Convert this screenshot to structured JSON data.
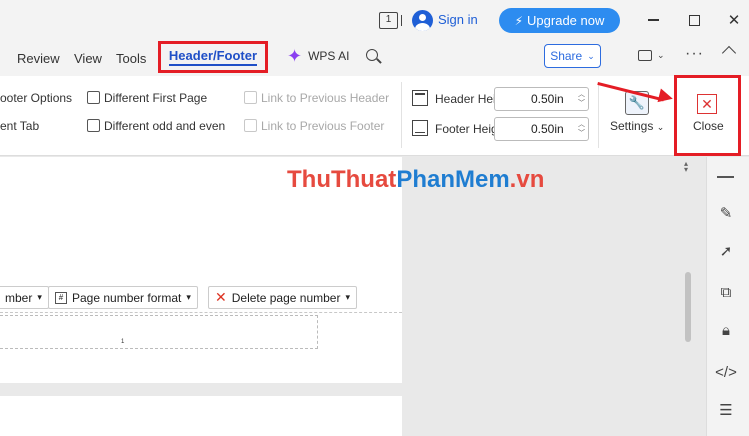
{
  "titlebar": {
    "page_count": "1",
    "signin_label": "Sign in",
    "upgrade_label": "Upgrade now"
  },
  "menu": {
    "items": [
      "Review",
      "View",
      "Tools"
    ],
    "active_tab": "Header/Footer",
    "wps_ai_label": "WPS AI",
    "share_label": "Share"
  },
  "ribbon": {
    "footer_options_label": "ooter Options",
    "ent_tab_label": "ent Tab",
    "different_first_page": "Different First Page",
    "different_odd_even": "Different odd and even",
    "link_prev_header": "Link to Previous Header",
    "link_prev_footer": "Link to Previous Footer",
    "header_height_label": "Header Height:",
    "header_height_value": "0.50in",
    "footer_height_label": "Footer Height:",
    "footer_height_value": "0.50in",
    "settings_label": "Settings",
    "close_label": "Close"
  },
  "watermark": {
    "part1": "ThuThuat",
    "part2": "PhanMem",
    "part3": ".vn"
  },
  "document": {
    "page_number_btn": "mber",
    "page_number_format_btn": "Page number format",
    "delete_page_number_btn": "Delete page number",
    "footer_page_number": "1"
  },
  "colors": {
    "highlight_red": "#e41d25",
    "accent_blue": "#2d8cf0",
    "active_tab_blue": "#1f4fc7"
  }
}
